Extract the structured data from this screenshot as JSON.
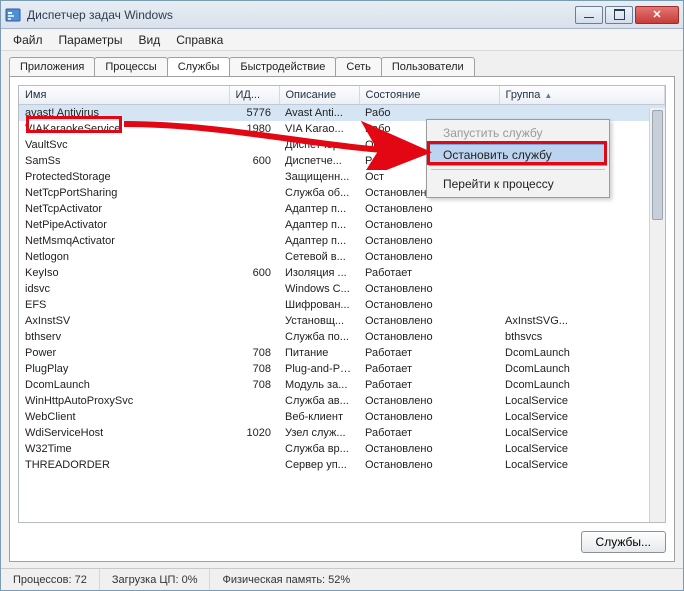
{
  "window": {
    "title": "Диспетчер задач Windows"
  },
  "menu": {
    "file": "Файл",
    "options": "Параметры",
    "view": "Вид",
    "help": "Справка"
  },
  "tabs": {
    "apps": "Приложения",
    "processes": "Процессы",
    "services": "Службы",
    "performance": "Быстродействие",
    "network": "Сеть",
    "users": "Пользователи"
  },
  "columns": {
    "name": "Имя",
    "id": "ИД...",
    "desc": "Описание",
    "state": "Состояние",
    "group": "Группа"
  },
  "rows": [
    {
      "name": "avast! Antivirus",
      "id": "5776",
      "desc": "Avast Anti...",
      "state": "Рабо",
      "group": ""
    },
    {
      "name": "VIAKaraokeService",
      "id": "1980",
      "desc": "VIA Karao...",
      "state": "Рабо",
      "group": ""
    },
    {
      "name": "VaultSvc",
      "id": "",
      "desc": "Диспетчер...",
      "state": "Ост",
      "group": ""
    },
    {
      "name": "SamSs",
      "id": "600",
      "desc": "Диспетче...",
      "state": "Рабо",
      "group": ""
    },
    {
      "name": "ProtectedStorage",
      "id": "",
      "desc": "Защищенн...",
      "state": "Ост",
      "group": ""
    },
    {
      "name": "NetTcpPortSharing",
      "id": "",
      "desc": "Служба об...",
      "state": "Остановлено",
      "group": ""
    },
    {
      "name": "NetTcpActivator",
      "id": "",
      "desc": "Адаптер п...",
      "state": "Остановлено",
      "group": ""
    },
    {
      "name": "NetPipeActivator",
      "id": "",
      "desc": "Адаптер п...",
      "state": "Остановлено",
      "group": ""
    },
    {
      "name": "NetMsmqActivator",
      "id": "",
      "desc": "Адаптер п...",
      "state": "Остановлено",
      "group": ""
    },
    {
      "name": "Netlogon",
      "id": "",
      "desc": "Сетевой в...",
      "state": "Остановлено",
      "group": ""
    },
    {
      "name": "KeyIso",
      "id": "600",
      "desc": "Изоляция ...",
      "state": "Работает",
      "group": ""
    },
    {
      "name": "idsvc",
      "id": "",
      "desc": "Windows C...",
      "state": "Остановлено",
      "group": ""
    },
    {
      "name": "EFS",
      "id": "",
      "desc": "Шифрован...",
      "state": "Остановлено",
      "group": ""
    },
    {
      "name": "AxInstSV",
      "id": "",
      "desc": "Установщ...",
      "state": "Остановлено",
      "group": "AxInstSVG..."
    },
    {
      "name": "bthserv",
      "id": "",
      "desc": "Служба по...",
      "state": "Остановлено",
      "group": "bthsvcs"
    },
    {
      "name": "Power",
      "id": "708",
      "desc": "Питание",
      "state": "Работает",
      "group": "DcomLaunch"
    },
    {
      "name": "PlugPlay",
      "id": "708",
      "desc": "Plug-and-Play",
      "state": "Работает",
      "group": "DcomLaunch"
    },
    {
      "name": "DcomLaunch",
      "id": "708",
      "desc": "Модуль за...",
      "state": "Работает",
      "group": "DcomLaunch"
    },
    {
      "name": "WinHttpAutoProxySvc",
      "id": "",
      "desc": "Служба ав...",
      "state": "Остановлено",
      "group": "LocalService"
    },
    {
      "name": "WebClient",
      "id": "",
      "desc": "Веб-клиент",
      "state": "Остановлено",
      "group": "LocalService"
    },
    {
      "name": "WdiServiceHost",
      "id": "1020",
      "desc": "Узел служ...",
      "state": "Работает",
      "group": "LocalService"
    },
    {
      "name": "W32Time",
      "id": "",
      "desc": "Служба вр...",
      "state": "Остановлено",
      "group": "LocalService"
    },
    {
      "name": "THREADORDER",
      "id": "",
      "desc": "Сервер уп...",
      "state": "Остановлено",
      "group": "LocalService"
    }
  ],
  "context_menu": {
    "start": "Запустить службу",
    "stop": "Остановить службу",
    "goto": "Перейти к процессу"
  },
  "buttons": {
    "services": "Службы..."
  },
  "status": {
    "processes": "Процессов: 72",
    "cpu": "Загрузка ЦП: 0%",
    "mem": "Физическая память: 52%"
  }
}
